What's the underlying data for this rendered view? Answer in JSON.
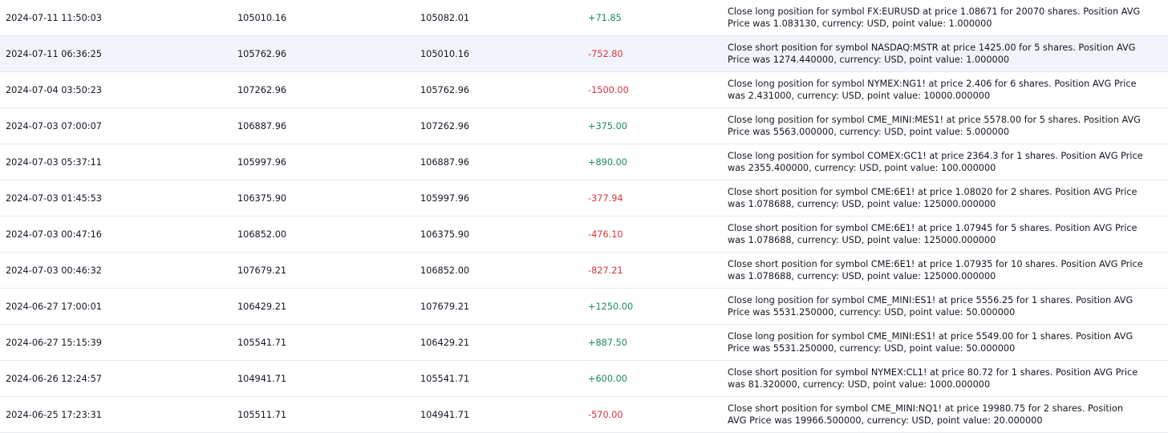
{
  "rows": [
    {
      "time": "2024-07-11 11:50:03",
      "balance_before": "105010.16",
      "balance_after": "105082.01",
      "pnl": "+71.85",
      "sign": "pos",
      "comment": "Close long position for symbol FX:EURUSD at price 1.08671 for 20070 shares. Position AVG Price was 1.083130, currency: USD, point value: 1.000000"
    },
    {
      "time": "2024-07-11 06:36:25",
      "balance_before": "105762.96",
      "balance_after": "105010.16",
      "pnl": "-752.80",
      "sign": "neg",
      "comment": "Close short position for symbol NASDAQ:MSTR at price 1425.00 for 5 shares. Position AVG Price was 1274.440000, currency: USD, point value: 1.000000"
    },
    {
      "time": "2024-07-04 03:50:23",
      "balance_before": "107262.96",
      "balance_after": "105762.96",
      "pnl": "-1500.00",
      "sign": "neg",
      "comment": "Close long position for symbol NYMEX:NG1! at price 2.406 for 6 shares. Position AVG Price was 2.431000, currency: USD, point value: 10000.000000"
    },
    {
      "time": "2024-07-03 07:00:07",
      "balance_before": "106887.96",
      "balance_after": "107262.96",
      "pnl": "+375.00",
      "sign": "pos",
      "comment": "Close long position for symbol CME_MINI:MES1! at price 5578.00 for 5 shares. Position AVG Price was 5563.000000, currency: USD, point value: 5.000000"
    },
    {
      "time": "2024-07-03 05:37:11",
      "balance_before": "105997.96",
      "balance_after": "106887.96",
      "pnl": "+890.00",
      "sign": "pos",
      "comment": "Close long position for symbol COMEX:GC1! at price 2364.3 for 1 shares. Position AVG Price was 2355.400000, currency: USD, point value: 100.000000"
    },
    {
      "time": "2024-07-03 01:45:53",
      "balance_before": "106375.90",
      "balance_after": "105997.96",
      "pnl": "-377.94",
      "sign": "neg",
      "comment": "Close short position for symbol CME:6E1! at price 1.08020 for 2 shares. Position AVG Price was 1.078688, currency: USD, point value: 125000.000000"
    },
    {
      "time": "2024-07-03 00:47:16",
      "balance_before": "106852.00",
      "balance_after": "106375.90",
      "pnl": "-476.10",
      "sign": "neg",
      "comment": "Close short position for symbol CME:6E1! at price 1.07945 for 5 shares. Position AVG Price was 1.078688, currency: USD, point value: 125000.000000"
    },
    {
      "time": "2024-07-03 00:46:32",
      "balance_before": "107679.21",
      "balance_after": "106852.00",
      "pnl": "-827.21",
      "sign": "neg",
      "comment": "Close short position for symbol CME:6E1! at price 1.07935 for 10 shares. Position AVG Price was 1.078688, currency: USD, point value: 125000.000000"
    },
    {
      "time": "2024-06-27 17:00:01",
      "balance_before": "106429.21",
      "balance_after": "107679.21",
      "pnl": "+1250.00",
      "sign": "pos",
      "comment": "Close long position for symbol CME_MINI:ES1! at price 5556.25 for 1 shares. Position AVG Price was 5531.250000, currency: USD, point value: 50.000000"
    },
    {
      "time": "2024-06-27 15:15:39",
      "balance_before": "105541.71",
      "balance_after": "106429.21",
      "pnl": "+887.50",
      "sign": "pos",
      "comment": "Close long position for symbol CME_MINI:ES1! at price 5549.00 for 1 shares. Position AVG Price was 5531.250000, currency: USD, point value: 50.000000"
    },
    {
      "time": "2024-06-26 12:24:57",
      "balance_before": "104941.71",
      "balance_after": "105541.71",
      "pnl": "+600.00",
      "sign": "pos",
      "comment": "Close short position for symbol NYMEX:CL1! at price 80.72 for 1 shares. Position AVG Price was 81.320000, currency: USD, point value: 1000.000000"
    },
    {
      "time": "2024-06-25 17:23:31",
      "balance_before": "105511.71",
      "balance_after": "104941.71",
      "pnl": "-570.00",
      "sign": "neg",
      "comment": "Close short position for symbol CME_MINI:NQ1! at price 19980.75 for 2 shares. Position AVG Price was 19966.500000, currency: USD, point value: 20.000000"
    }
  ],
  "colors": {
    "positive": "#1a8a68",
    "negative": "#d8343d",
    "row_highlight": "#f1f4fb",
    "row_border": "#e8eaef"
  }
}
